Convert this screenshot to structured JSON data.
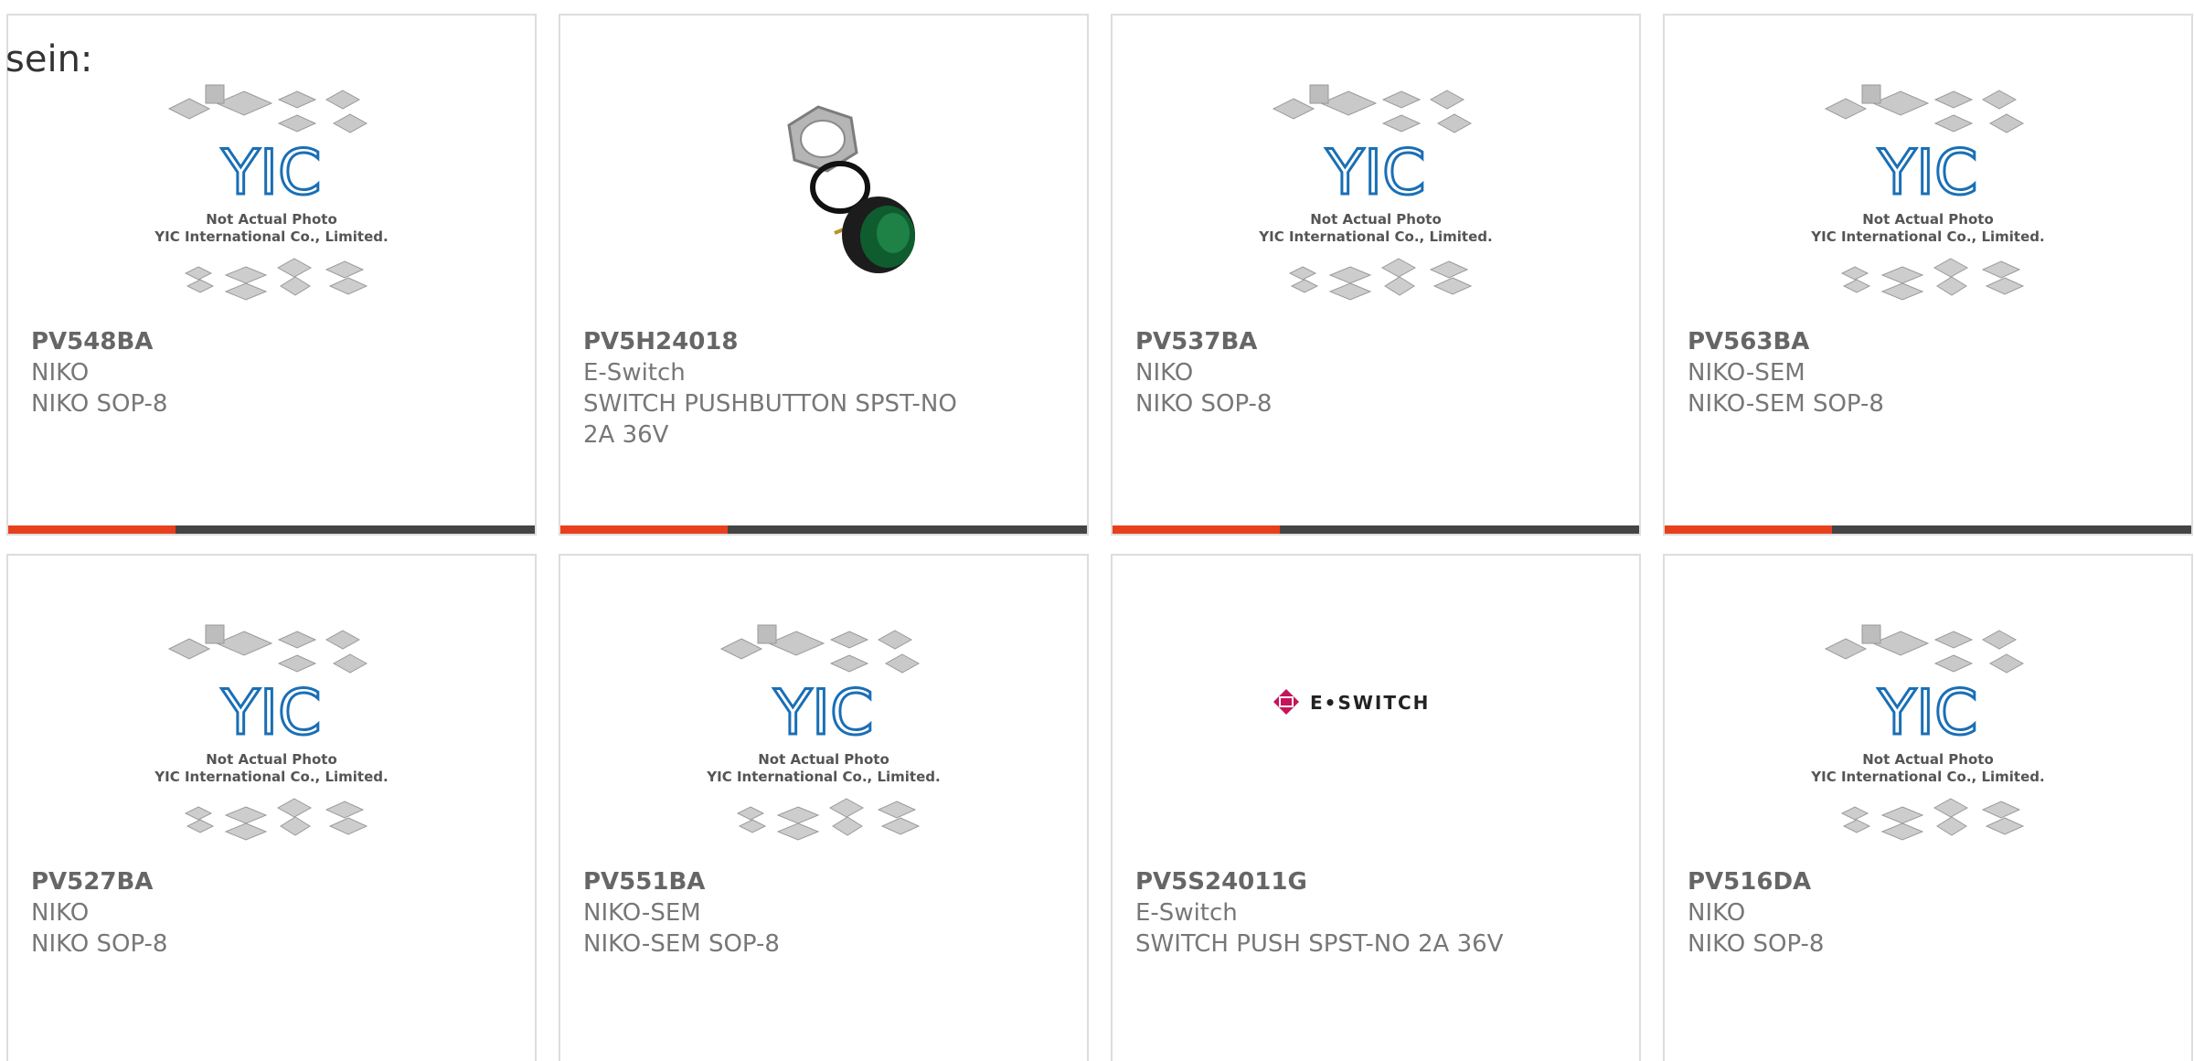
{
  "intro": {
    "text": "sein:"
  },
  "brand": {
    "placeholder_mark": "YIC",
    "placeholder_line1": "Not Actual Photo",
    "placeholder_line2": "YIC International Co., Limited.",
    "eswitch_logo": "E•SWITCH"
  },
  "colors": {
    "accent": "#e8401c",
    "bar": "#444444",
    "yic_blue": "#1a6fb5",
    "eswitch_magenta": "#c4145a"
  },
  "products": [
    {
      "part": "PV548BA",
      "manufacturer": "NIKO",
      "description": "NIKO SOP-8",
      "image": "yic-placeholder"
    },
    {
      "part": "PV5H24018",
      "manufacturer": "E-Switch",
      "description": "SWITCH PUSHBUTTON SPST-NO 2A 36V",
      "image": "pushbutton-photo"
    },
    {
      "part": "PV537BA",
      "manufacturer": "NIKO",
      "description": "NIKO SOP-8",
      "image": "yic-placeholder"
    },
    {
      "part": "PV563BA",
      "manufacturer": "NIKO-SEM",
      "description": "NIKO-SEM SOP-8",
      "image": "yic-placeholder"
    },
    {
      "part": "PV527BA",
      "manufacturer": "NIKO",
      "description": "NIKO SOP-8",
      "image": "yic-placeholder"
    },
    {
      "part": "PV551BA",
      "manufacturer": "NIKO-SEM",
      "description": "NIKO-SEM SOP-8",
      "image": "yic-placeholder"
    },
    {
      "part": "PV5S24011G",
      "manufacturer": "E-Switch",
      "description": "SWITCH PUSH SPST-NO 2A 36V",
      "image": "eswitch-logo"
    },
    {
      "part": "PV516DA",
      "manufacturer": "NIKO",
      "description": "NIKO SOP-8",
      "image": "yic-placeholder"
    }
  ]
}
